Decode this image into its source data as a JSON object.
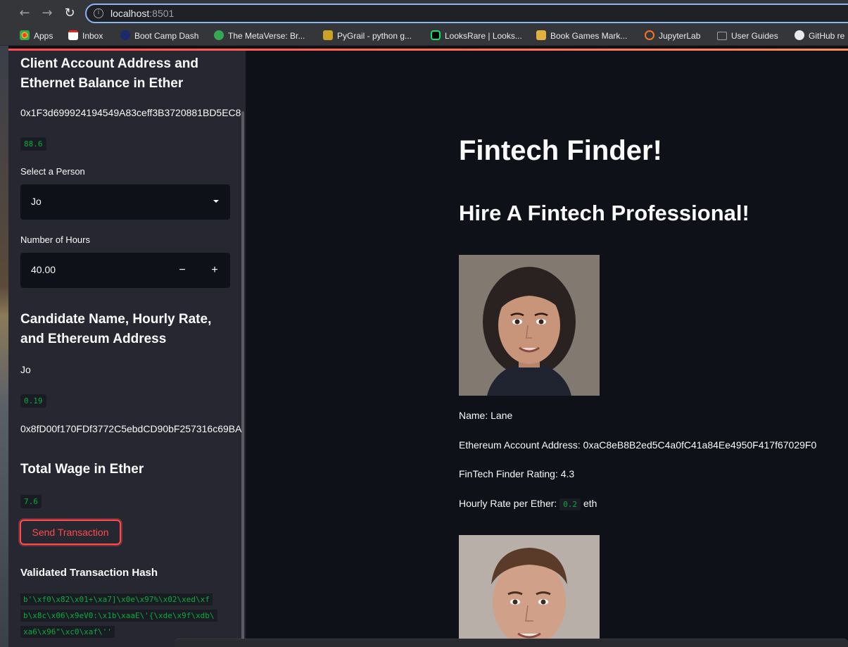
{
  "browser": {
    "url_host": "localhost",
    "url_port": ":8501",
    "back_icon": "arrow-left-icon",
    "forward_icon": "arrow-right-icon",
    "reload_icon": "reload-icon",
    "bookmarks": [
      {
        "label": "Apps",
        "icon": "apps-grid-icon",
        "color": "#ea4335"
      },
      {
        "label": "Inbox",
        "icon": "gmail-icon",
        "color": "#d93025"
      },
      {
        "label": "Boot Camp Dash",
        "icon": "bootcamp-icon",
        "color": "#1a2a6c"
      },
      {
        "label": "The MetaVerse: Br...",
        "icon": "etf-icon",
        "color": "#34a853"
      },
      {
        "label": "PyGrail - python g...",
        "icon": "trophy-icon",
        "color": "#c9a227"
      },
      {
        "label": "LooksRare | Looks...",
        "icon": "looksrare-icon",
        "color": "#0ce466"
      },
      {
        "label": "Book Games Mark...",
        "icon": "book-games-icon",
        "color": "#e0b040"
      },
      {
        "label": "JupyterLab",
        "icon": "jupyter-icon",
        "color": "#f37626"
      },
      {
        "label": "User Guides",
        "icon": "folder-icon",
        "color": "#9aa0a6"
      },
      {
        "label": "GitHub re",
        "icon": "github-icon",
        "color": "#e8eaed"
      }
    ]
  },
  "sidebar": {
    "account_heading": "Client Account Address and Ethernet Balance in Ether",
    "account_address": "0x1F3d699924194549A83ceff3B3720881BD5EC8",
    "balance": "88.6",
    "select_label": "Select a Person",
    "select_value": "Jo",
    "hours_label": "Number of Hours",
    "hours_value": "40.00",
    "candidate_heading": "Candidate Name, Hourly Rate, and Ethereum Address",
    "candidate_name": "Jo",
    "candidate_rate": "0.19",
    "candidate_address": "0x8fD00f170FDf3772C5ebdCD90bF257316c69BA",
    "wage_heading": "Total Wage in Ether",
    "wage_value": "7.6",
    "send_label": "Send Transaction",
    "hash_heading": "Validated Transaction Hash",
    "hash_lines": [
      "b'\\xf0\\x82\\x01+\\xa7]\\x0e\\x97%\\x02\\xed\\xf",
      "b\\x8c\\x06\\x9eV0:\\x1b\\xaaE\\'{\\xde\\x9f\\xdb\\",
      "xa6\\x96\"\\xc0\\xaf\\''"
    ]
  },
  "main": {
    "title": "Fintech Finder!",
    "subtitle": "Hire A Fintech Professional!",
    "profile": {
      "name_line": "Name: Lane",
      "address_line": "Ethereum Account Address: 0xaC8eB8B2ed5C4a0fC41a84Ee4950F417f67029F0",
      "rating_line": "FinTech Finder Rating: 4.3",
      "rate_prefix": "Hourly Rate per Ether:",
      "rate_value": "0.2",
      "rate_suffix": "eth"
    }
  }
}
